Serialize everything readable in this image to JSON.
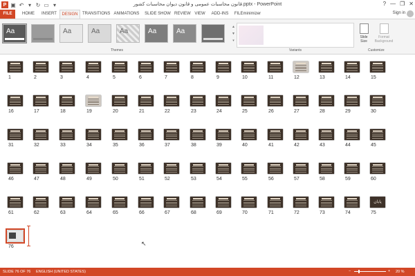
{
  "window": {
    "title": "قانون محاسبات عمومی و قانون دیوان محاسبات کشور.pptx - PowerPoint"
  },
  "window_controls": [
    "?",
    "—",
    "❐",
    "✕"
  ],
  "account": {
    "sign_in": "Sign in"
  },
  "tabs": [
    "FILE",
    "HOME",
    "INSERT",
    "DESIGN",
    "TRANSITIONS",
    "ANIMATIONS",
    "SLIDE SHOW",
    "REVIEW",
    "VIEW",
    "ADD-INS",
    "FILEminimizer"
  ],
  "active_tab": "DESIGN",
  "ribbon": {
    "theme_sample": "Aa",
    "group_themes": "Themes",
    "group_variants": "Variants",
    "group_customize": "Customize",
    "slide_size": "Slide Size",
    "format_background": "Format Background"
  },
  "slide_numbers": [
    "1",
    "2",
    "3",
    "4",
    "5",
    "6",
    "7",
    "8",
    "9",
    "10",
    "11",
    "12",
    "13",
    "14",
    "15",
    "16",
    "17",
    "18",
    "19",
    "20",
    "21",
    "22",
    "23",
    "24",
    "25",
    "26",
    "27",
    "28",
    "29",
    "30",
    "31",
    "32",
    "33",
    "34",
    "35",
    "36",
    "37",
    "38",
    "39",
    "40",
    "41",
    "42",
    "43",
    "44",
    "45",
    "46",
    "47",
    "48",
    "49",
    "50",
    "51",
    "52",
    "53",
    "54",
    "55",
    "56",
    "57",
    "58",
    "59",
    "60",
    "61",
    "62",
    "63",
    "64",
    "65",
    "66",
    "67",
    "68",
    "69",
    "70",
    "71",
    "72",
    "73",
    "74",
    "75",
    "76"
  ],
  "slide_75_text": "پایان",
  "selected_slide": "76",
  "status": {
    "slide": "SLIDE 76 OF 76",
    "language": "ENGLISH (UNITED STATES)",
    "zoom": "20 %",
    "zoom_minus": "−",
    "zoom_plus": "+"
  },
  "colors": {
    "accent": "#d24726",
    "slide_bg": "#3e3229"
  }
}
